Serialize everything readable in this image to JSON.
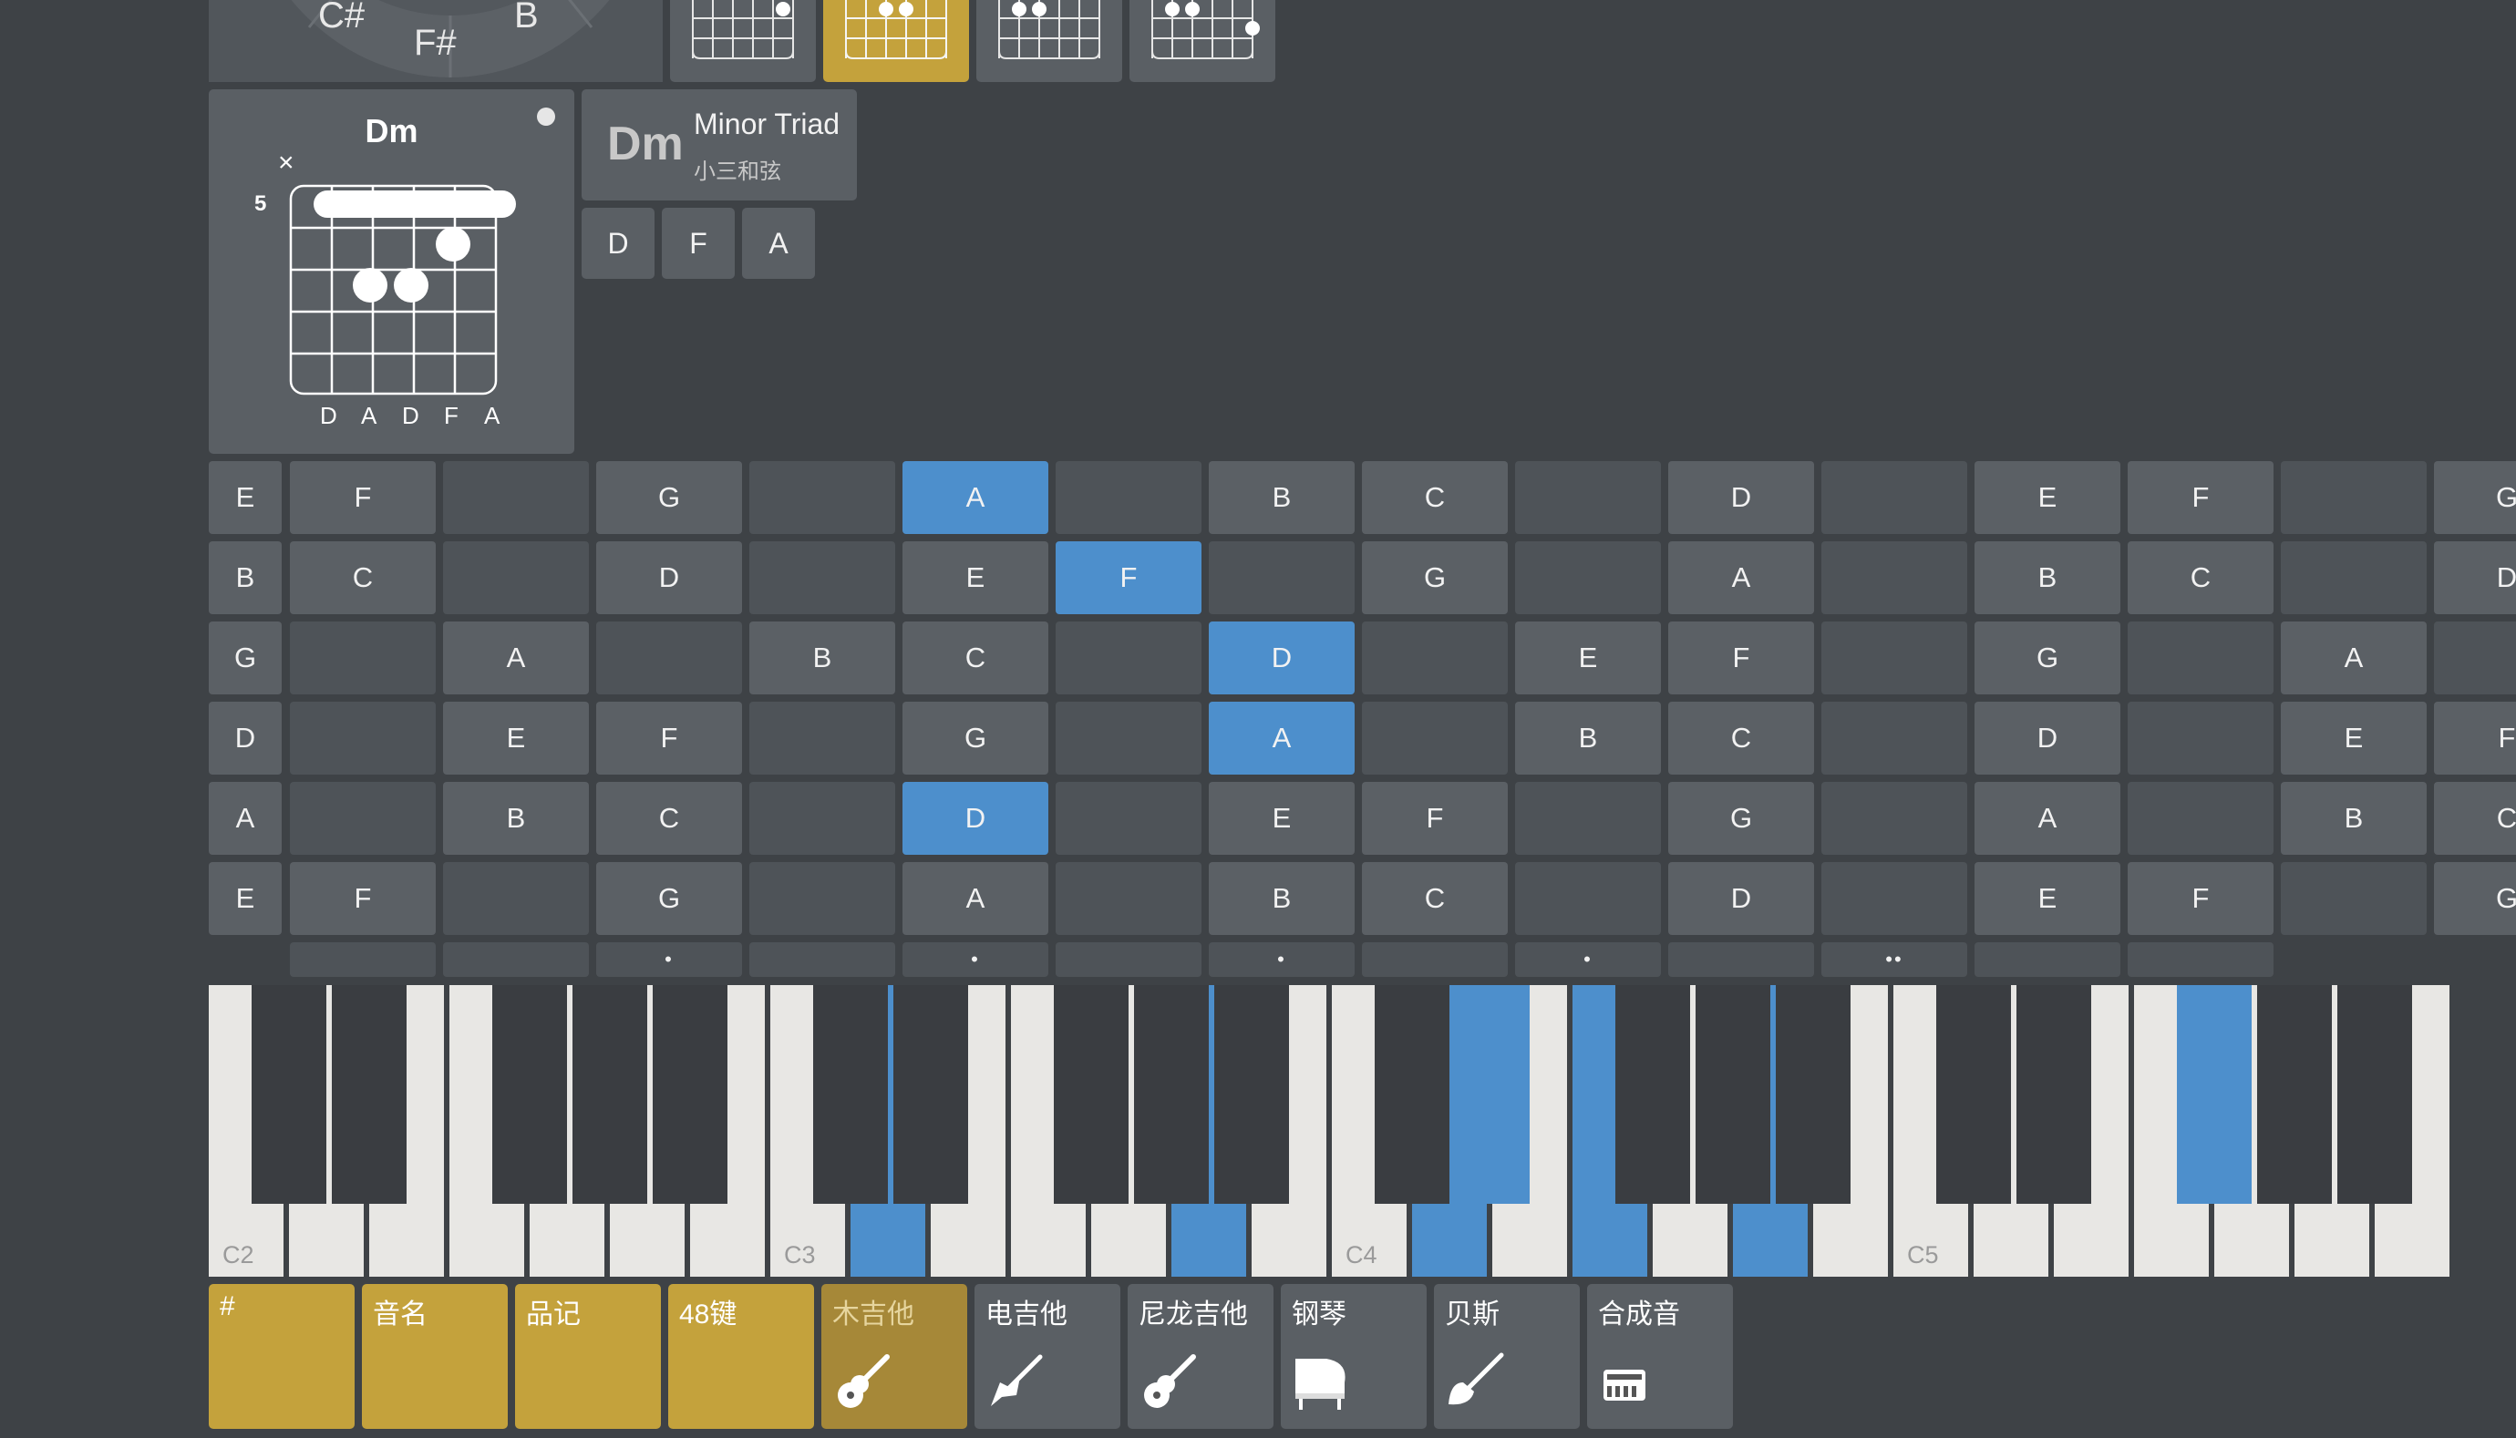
{
  "circle_of_fifths": {
    "labels": [
      "C#",
      "F#",
      "B"
    ]
  },
  "chord_diagram": {
    "name": "Dm",
    "start_fret": "5",
    "muted_marker": "×",
    "string_notes": [
      "D",
      "A",
      "D",
      "F",
      "A"
    ]
  },
  "chord_info": {
    "name": "Dm",
    "type_en": "Minor Triad",
    "type_cn": "小三和弦",
    "notes": [
      "D",
      "F",
      "A"
    ]
  },
  "fretboard": {
    "rows": [
      [
        "E",
        "F",
        "",
        "G",
        "",
        "A",
        "",
        "B",
        "C",
        "",
        "D",
        "",
        "E",
        "F",
        "",
        "G"
      ],
      [
        "B",
        "C",
        "",
        "D",
        "",
        "E",
        "F",
        "",
        "G",
        "",
        "A",
        "",
        "B",
        "C",
        "",
        "D"
      ],
      [
        "G",
        "",
        "A",
        "",
        "B",
        "C",
        "",
        "D",
        "",
        "E",
        "F",
        "",
        "G",
        "",
        "A",
        ""
      ],
      [
        "D",
        "",
        "E",
        "F",
        "",
        "G",
        "",
        "A",
        "",
        "B",
        "C",
        "",
        "D",
        "",
        "E",
        "F"
      ],
      [
        "A",
        "",
        "B",
        "C",
        "",
        "D",
        "",
        "E",
        "F",
        "",
        "G",
        "",
        "A",
        "",
        "B",
        "C"
      ],
      [
        "E",
        "F",
        "",
        "G",
        "",
        "A",
        "",
        "B",
        "C",
        "",
        "D",
        "",
        "E",
        "F",
        "",
        "G"
      ]
    ],
    "highlighted": [
      [
        0,
        5
      ],
      [
        1,
        6
      ],
      [
        2,
        7
      ],
      [
        3,
        7
      ],
      [
        4,
        5
      ]
    ],
    "fret_markers": [
      "",
      "",
      "•",
      "",
      "•",
      "",
      "•",
      "",
      "•",
      "",
      "••",
      "",
      ""
    ]
  },
  "piano": {
    "octave_labels": {
      "C2": "C2",
      "C3": "C3",
      "C4": "C4",
      "C5": "C5"
    }
  },
  "bottom_buttons": [
    {
      "label": "#",
      "state": "gold",
      "icon": ""
    },
    {
      "label": "音名",
      "state": "gold",
      "icon": ""
    },
    {
      "label": "品记",
      "state": "gold",
      "icon": ""
    },
    {
      "label": "48键",
      "state": "gold",
      "icon": ""
    },
    {
      "label": "木吉他",
      "state": "selected",
      "icon": "acoustic-guitar-icon"
    },
    {
      "label": "电吉他",
      "state": "normal",
      "icon": "electric-guitar-icon"
    },
    {
      "label": "尼龙吉他",
      "state": "normal",
      "icon": "nylon-guitar-icon"
    },
    {
      "label": "钢琴",
      "state": "normal",
      "icon": "grand-piano-icon"
    },
    {
      "label": "贝斯",
      "state": "normal",
      "icon": "bass-guitar-icon"
    },
    {
      "label": "合成音",
      "state": "normal",
      "icon": "synthesizer-icon"
    }
  ],
  "colors": {
    "highlight": "#4d8fcc",
    "gold": "#c4a23c",
    "background": "#3e4246"
  }
}
